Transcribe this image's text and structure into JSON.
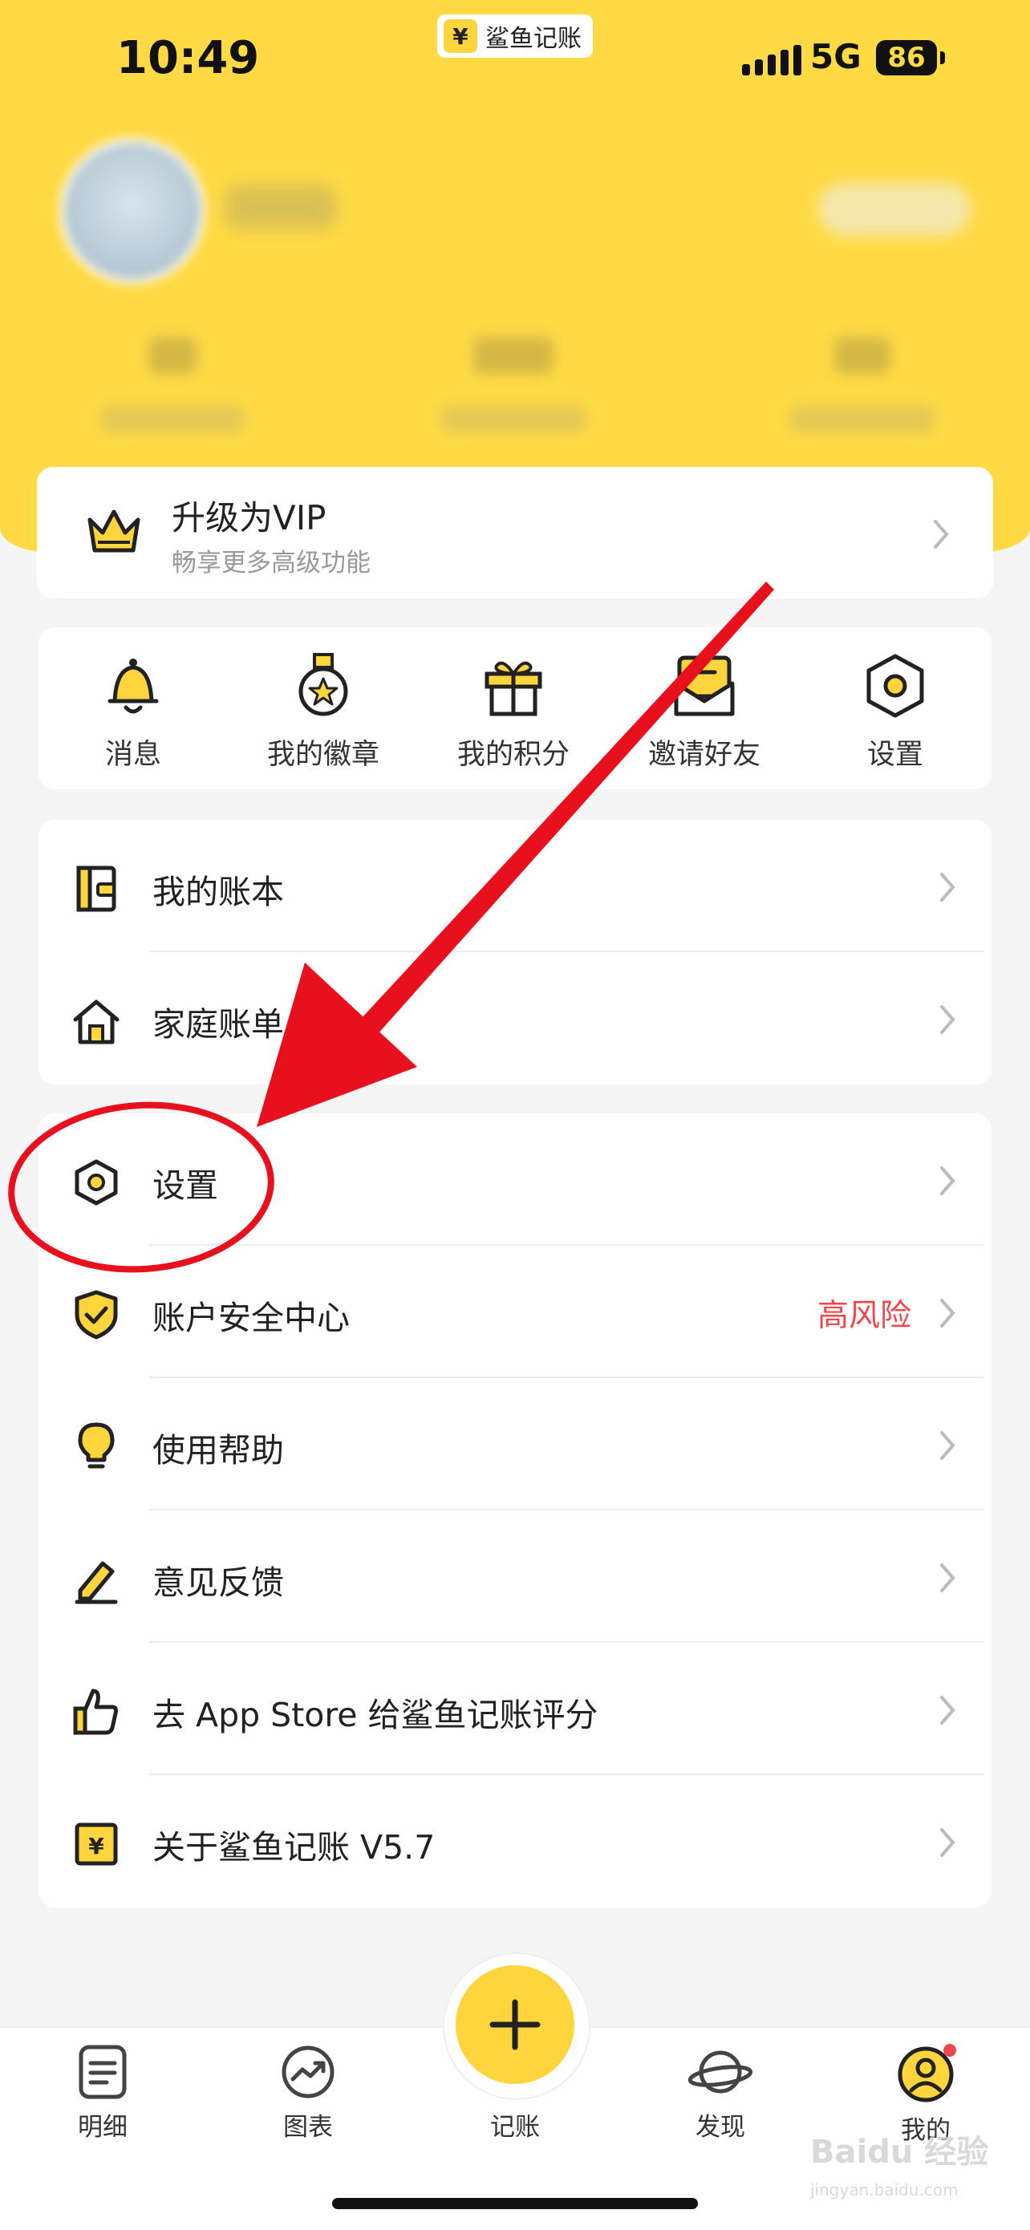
{
  "status_bar": {
    "time": "10:49",
    "app_name": "鲨鱼记账",
    "app_badge_glyph": "¥",
    "network": "5G",
    "battery": "86"
  },
  "colors": {
    "brand_yellow": "#ffda45",
    "accent_yellow": "#ffd53d",
    "risk_red": "#f0474c",
    "annotation_red": "#e8101d"
  },
  "vip": {
    "title": "升级为VIP",
    "subtitle": "畅享更多高级功能",
    "icon": "crown-icon"
  },
  "quick_actions": [
    {
      "label": "消息",
      "icon": "bell-icon"
    },
    {
      "label": "我的徽章",
      "icon": "medal-icon"
    },
    {
      "label": "我的积分",
      "icon": "gift-icon"
    },
    {
      "label": "邀请好友",
      "icon": "envelope-icon"
    },
    {
      "label": "设置",
      "icon": "hexagon-settings-icon"
    }
  ],
  "menu_group1": [
    {
      "label": "我的账本",
      "icon": "ledger-icon"
    },
    {
      "label": "家庭账单",
      "icon": "house-icon"
    }
  ],
  "menu_group2": [
    {
      "label": "设置",
      "icon": "hexagon-settings-icon"
    },
    {
      "label": "账户安全中心",
      "icon": "shield-check-icon",
      "badge": "高风险"
    },
    {
      "label": "使用帮助",
      "icon": "lightbulb-icon"
    },
    {
      "label": "意见反馈",
      "icon": "pencil-icon"
    },
    {
      "label": "去 App Store 给鲨鱼记账评分",
      "icon": "thumbs-up-icon"
    },
    {
      "label": "关于鲨鱼记账 V5.7",
      "icon": "yuan-box-icon"
    }
  ],
  "tabbar": [
    {
      "label": "明细",
      "icon": "document-icon"
    },
    {
      "label": "图表",
      "icon": "chart-circle-icon"
    },
    {
      "label": "记账",
      "icon": "plus-icon"
    },
    {
      "label": "发现",
      "icon": "planet-icon"
    },
    {
      "label": "我的",
      "icon": "user-icon",
      "active": true
    }
  ],
  "watermark": {
    "text": "Baidu 经验",
    "sub": "jingyan.baidu.com"
  }
}
